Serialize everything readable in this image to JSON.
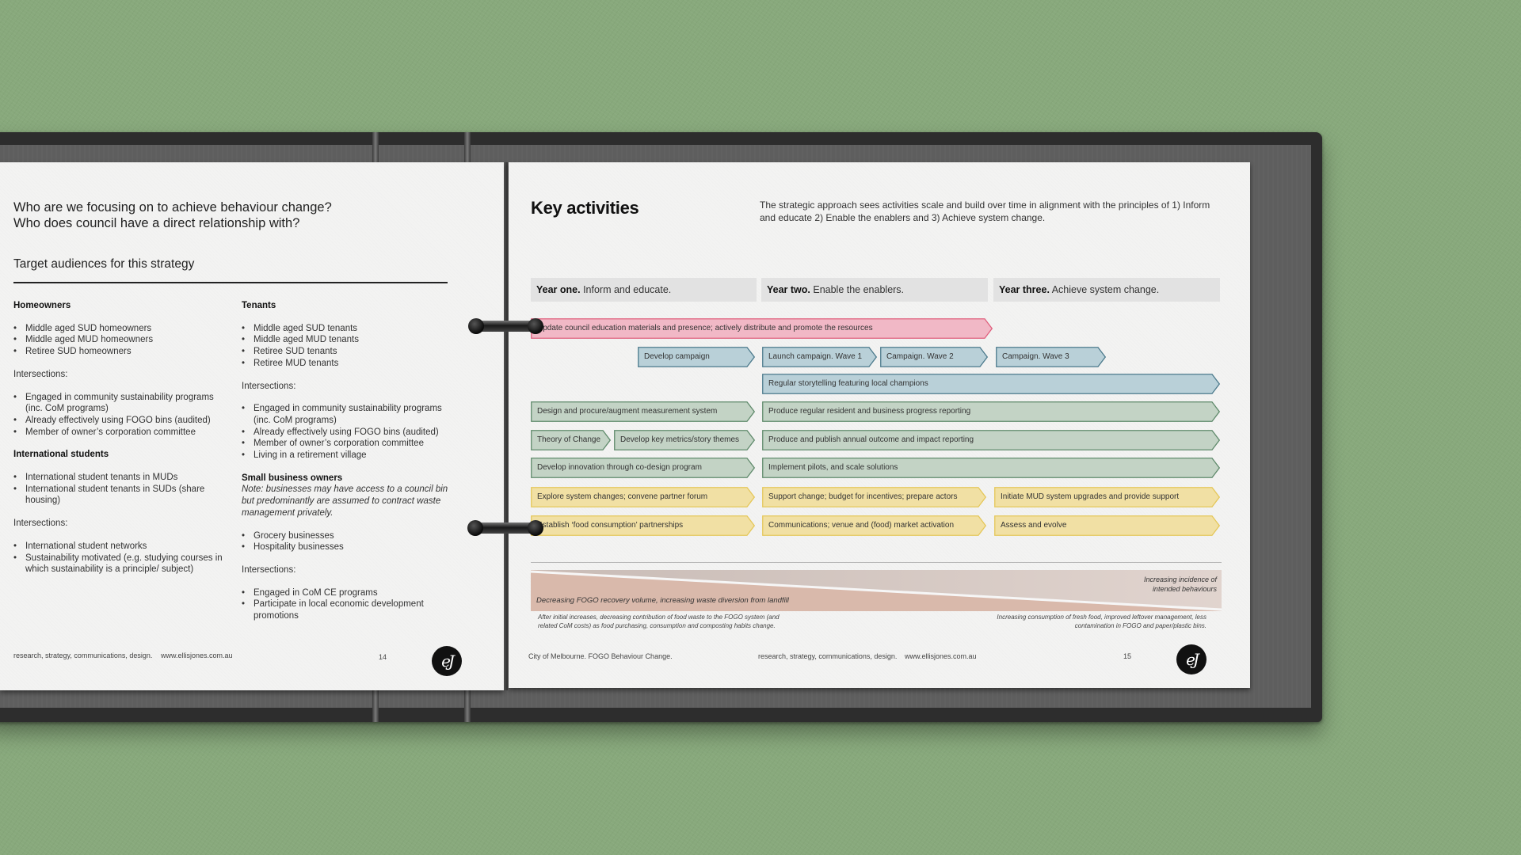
{
  "left_page": {
    "questions": [
      "Who are we focusing on to achieve behaviour change?",
      "Who does council have a direct relationship with?"
    ],
    "subtitle": "Target audiences for this strategy",
    "columns": [
      {
        "sections": [
          {
            "heading": "Homeowners",
            "items": [
              "Middle aged SUD homeowners",
              "Middle aged MUD homeowners",
              "Retiree SUD homeowners"
            ],
            "intersections_label": "Intersections:",
            "intersections": [
              "Engaged in community sustainability programs (inc. CoM programs)",
              "Already effectively using FOGO bins (audited)",
              "Member of owner’s corporation committee"
            ]
          },
          {
            "heading": "International students",
            "items": [
              "International student tenants in MUDs",
              "International student tenants in SUDs (share housing)"
            ],
            "intersections_label": "Intersections:",
            "intersections": [
              "International student networks",
              "Sustainability motivated (e.g. studying courses in which sustainability is a principle/ subject)"
            ]
          }
        ]
      },
      {
        "sections": [
          {
            "heading": "Tenants",
            "items": [
              "Middle aged SUD tenants",
              "Middle aged MUD tenants",
              "Retiree SUD tenants",
              "Retiree MUD tenants"
            ],
            "intersections_label": "Intersections:",
            "intersections": [
              "Engaged in community sustainability programs (inc. CoM programs)",
              "Already effectively using FOGO bins (audited)",
              "Member of owner’s corporation committee",
              "Living in a retirement village"
            ]
          },
          {
            "heading": "Small business owners",
            "note": "Note: businesses may have access to a council bin but predominantly are assumed to contract waste management privately.",
            "items": [
              "Grocery businesses",
              "Hospitality businesses"
            ],
            "intersections_label": "Intersections:",
            "intersections": [
              "Engaged in CoM CE programs",
              "Participate in local economic development promotions"
            ]
          }
        ]
      }
    ],
    "footer": {
      "tagline": "research, strategy, communications, design.",
      "website": "www.ellisjones.com.au",
      "page_number": "14",
      "logo": "eJ"
    }
  },
  "right_page": {
    "title": "Key activities",
    "intro": "The strategic approach sees activities scale and build over time in alignment with the principles of 1) Inform and educate   2) Enable the enablers and 3) Achieve system change.",
    "years": [
      {
        "bold": "Year one.",
        "text": " Inform and educate."
      },
      {
        "bold": "Year two.",
        "text": " Enable the enablers."
      },
      {
        "bold": "Year three.",
        "text": " Achieve system change."
      }
    ],
    "colors": {
      "pink": {
        "fill": "#f1b8c6",
        "stroke": "#e0607e"
      },
      "blue": {
        "fill": "#b9d0d8",
        "stroke": "#4c7a8c"
      },
      "green": {
        "fill": "#c3d3c5",
        "stroke": "#5f8a6b"
      },
      "yellow": {
        "fill": "#f1e0a4",
        "stroke": "#e5c75a"
      }
    },
    "activities": [
      {
        "label": "Update council education materials and presence; actively distribute and promote the resources",
        "color": "pink"
      },
      {
        "label": "Develop campaign",
        "color": "blue"
      },
      {
        "label": "Launch campaign. Wave 1",
        "color": "blue"
      },
      {
        "label": "Campaign. Wave 2",
        "color": "blue"
      },
      {
        "label": "Campaign. Wave 3",
        "color": "blue"
      },
      {
        "label": "Regular storytelling featuring local champions",
        "color": "blue"
      },
      {
        "label": "Design and procure/augment measurement system",
        "color": "green"
      },
      {
        "label": "Produce regular resident and business progress reporting",
        "color": "green"
      },
      {
        "label": "Theory of Change",
        "color": "green"
      },
      {
        "label": "Develop key metrics/story themes",
        "color": "green"
      },
      {
        "label": "Produce and publish annual outcome and impact reporting",
        "color": "green"
      },
      {
        "label": "Develop innovation through co-design program",
        "color": "green"
      },
      {
        "label": "Implement pilots, and scale solutions",
        "color": "green"
      },
      {
        "label": "Explore system changes; convene partner forum",
        "color": "yellow"
      },
      {
        "label": "Support change; budget for incentives; prepare actors",
        "color": "yellow"
      },
      {
        "label": "Initiate MUD system upgrades and provide support",
        "color": "yellow"
      },
      {
        "label": "Establish ‘food consumption’ partnerships",
        "color": "yellow"
      },
      {
        "label": "Communications; venue and (food) market activation",
        "color": "yellow"
      },
      {
        "label": "Assess and evolve",
        "color": "yellow"
      }
    ],
    "trend": {
      "left_label": "Decreasing FOGO recovery volume, increasing waste diversion from landfill",
      "right_label": "Increasing incidence of intended behaviours",
      "note_left": "After initial increases, decreasing contribution of food waste to the FOGO system (and related CoM costs) as food purchasing, consumption and composting habits change.",
      "note_right": "Increasing consumption of fresh food, improved leftover management, less contamination in FOGO and paper/plastic bins.",
      "color": "#d9b9ab"
    },
    "footer": {
      "doc_title": "City of Melbourne. FOGO Behaviour Change.",
      "tagline": "research, strategy, communications, design.",
      "website": "www.ellisjones.com.au",
      "page_number": "15",
      "logo": "eJ"
    }
  }
}
